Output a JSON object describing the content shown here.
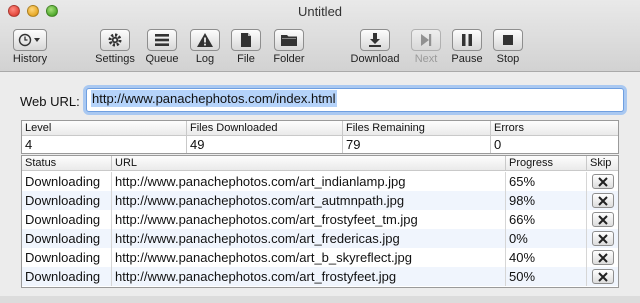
{
  "window": {
    "title": "Untitled"
  },
  "toolbar": {
    "history": "History",
    "settings": "Settings",
    "queue": "Queue",
    "log": "Log",
    "file": "File",
    "folder": "Folder",
    "download": "Download",
    "next": "Next",
    "pause": "Pause",
    "stop": "Stop"
  },
  "url": {
    "label": "Web URL:",
    "value": "http://www.panachephotos.com/index.html"
  },
  "stats": {
    "headers": [
      "Level",
      "Files Downloaded",
      "Files Remaining",
      "Errors"
    ],
    "values": [
      "4",
      "49",
      "79",
      "0"
    ]
  },
  "downloads": {
    "headers": [
      "Status",
      "URL",
      "Progress",
      "Skip"
    ],
    "rows": [
      {
        "status": "Downloading",
        "url": "http://www.panachephotos.com/art_indianlamp.jpg",
        "progress": "65%"
      },
      {
        "status": "Downloading",
        "url": "http://www.panachephotos.com/art_autmnpath.jpg",
        "progress": "98%"
      },
      {
        "status": "Downloading",
        "url": "http://www.panachephotos.com/art_frostyfeet_tm.jpg",
        "progress": "66%"
      },
      {
        "status": "Downloading",
        "url": "http://www.panachephotos.com/art_fredericas.jpg",
        "progress": "0%"
      },
      {
        "status": "Downloading",
        "url": "http://www.panachephotos.com/art_b_skyreflect.jpg",
        "progress": "40%"
      },
      {
        "status": "Downloading",
        "url": "http://www.panachephotos.com/art_frostyfeet.jpg",
        "progress": "50%"
      }
    ]
  },
  "icons": {
    "history": "clock-icon",
    "settings": "gear-icon",
    "queue": "list-icon",
    "log": "warning-icon",
    "file": "document-icon",
    "folder": "folder-icon",
    "download": "download-icon",
    "next": "next-icon",
    "pause": "pause-icon",
    "stop": "stop-icon",
    "skip": "close-icon"
  }
}
